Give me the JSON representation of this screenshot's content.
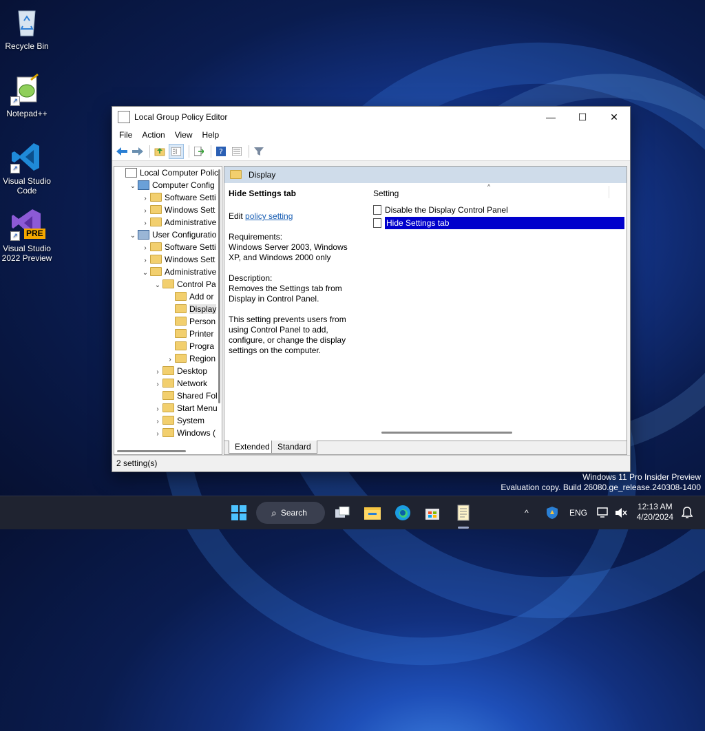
{
  "desktop": {
    "icons": [
      {
        "label": "Recycle Bin"
      },
      {
        "label": "Notepad++"
      },
      {
        "label_line1": "Visual Studio",
        "label_line2": "Code"
      },
      {
        "label_line1": "Visual Studio",
        "label_line2": "2022 Preview",
        "badge": "PRE"
      }
    ],
    "watermark": {
      "line1": "Windows 11 Pro Insider Preview",
      "line2": "Evaluation copy. Build 26080.ge_release.240308-1400"
    }
  },
  "window": {
    "title": "Local Group Policy Editor",
    "controls": {
      "minimize": "—",
      "maximize": "☐",
      "close": "✕"
    },
    "menu": [
      "File",
      "Action",
      "View",
      "Help"
    ],
    "toolbar_icons": [
      "back-icon",
      "forward-icon",
      "up-folder-icon",
      "show-hide-tree-icon",
      "export-list-icon",
      "help-icon",
      "properties-icon",
      "filter-icon"
    ],
    "tree": [
      {
        "label": "Local Computer Polic",
        "indent": 0,
        "expander": "",
        "icon": "doc"
      },
      {
        "label": "Computer Config",
        "indent": 1,
        "expander": "⌄",
        "icon": "computer"
      },
      {
        "label": "Software Setti",
        "indent": 2,
        "expander": "›",
        "icon": "folder"
      },
      {
        "label": "Windows Sett",
        "indent": 2,
        "expander": "›",
        "icon": "folder"
      },
      {
        "label": "Administrative",
        "indent": 2,
        "expander": "›",
        "icon": "folder"
      },
      {
        "label": "User Configuratio",
        "indent": 1,
        "expander": "⌄",
        "icon": "user"
      },
      {
        "label": "Software Setti",
        "indent": 2,
        "expander": "›",
        "icon": "folder"
      },
      {
        "label": "Windows Sett",
        "indent": 2,
        "expander": "›",
        "icon": "folder"
      },
      {
        "label": "Administrative",
        "indent": 2,
        "expander": "⌄",
        "icon": "folder"
      },
      {
        "label": "Control Pa",
        "indent": 3,
        "expander": "⌄",
        "icon": "folder"
      },
      {
        "label": "Add or",
        "indent": 4,
        "expander": "",
        "icon": "folder"
      },
      {
        "label": "Display",
        "indent": 4,
        "expander": "",
        "icon": "folder",
        "selected": true
      },
      {
        "label": "Person",
        "indent": 4,
        "expander": "",
        "icon": "folder"
      },
      {
        "label": "Printer",
        "indent": 4,
        "expander": "",
        "icon": "folder"
      },
      {
        "label": "Progra",
        "indent": 4,
        "expander": "",
        "icon": "folder"
      },
      {
        "label": "Region",
        "indent": 4,
        "expander": "›",
        "icon": "folder"
      },
      {
        "label": "Desktop",
        "indent": 3,
        "expander": "›",
        "icon": "folder"
      },
      {
        "label": "Network",
        "indent": 3,
        "expander": "›",
        "icon": "folder"
      },
      {
        "label": "Shared Fol",
        "indent": 3,
        "expander": "",
        "icon": "folder"
      },
      {
        "label": "Start Menu",
        "indent": 3,
        "expander": "›",
        "icon": "folder"
      },
      {
        "label": "System",
        "indent": 3,
        "expander": "›",
        "icon": "folder"
      },
      {
        "label": "Windows (",
        "indent": 3,
        "expander": "›",
        "icon": "folder"
      }
    ],
    "right_header": "Display",
    "description": {
      "title": "Hide Settings tab",
      "edit_prefix": "Edit ",
      "edit_link": "policy setting ",
      "requirements_label": "Requirements:",
      "requirements_text": "Windows Server 2003, Windows XP, and Windows 2000 only",
      "description_label": "Description:",
      "description_text": "Removes the Settings tab from Display in Control Panel.",
      "detail_text": "This setting prevents users from using Control Panel to add, configure, or change the display settings on the computer."
    },
    "list": {
      "column_header": "Setting",
      "sort_indicator": "^",
      "items": [
        {
          "label": "Disable the Display Control Panel",
          "selected": false
        },
        {
          "label": "Hide Settings tab",
          "selected": true
        }
      ]
    },
    "tabs": [
      "Extended",
      "Standard"
    ],
    "status": "2 setting(s)"
  },
  "taskbar": {
    "search_label": "Search",
    "tray": {
      "chevron": "^",
      "lang": "ENG",
      "time": "12:13 AM",
      "date": "4/20/2024"
    }
  },
  "colors": {
    "selection": "#0000cc",
    "header_band": "#cfdcea",
    "taskbar": "#1f2330"
  }
}
